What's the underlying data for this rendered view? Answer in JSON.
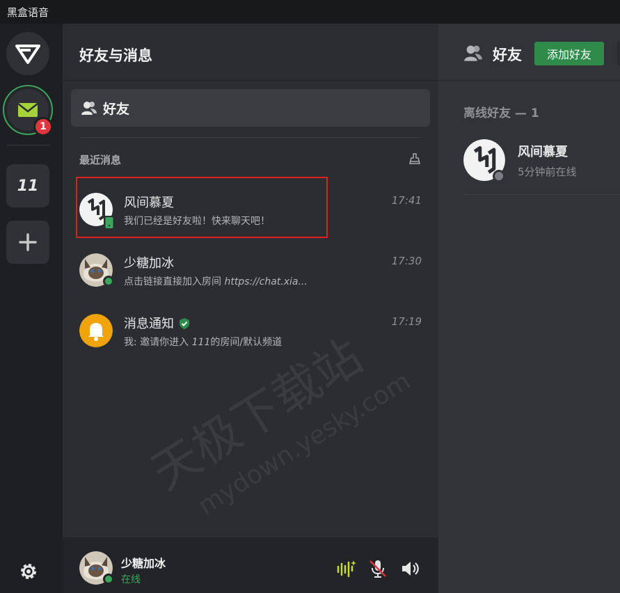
{
  "app": {
    "title": "黑盒语音"
  },
  "rail": {
    "mail_badge": "1",
    "server_label": "11"
  },
  "mid": {
    "header": "好友与消息",
    "friends_button": "好友",
    "recent_label": "最近消息",
    "messages": [
      {
        "name": "风间慕夏",
        "time": "17:41",
        "preview": "我们已经是好友啦！快来聊天吧！"
      },
      {
        "name": "少糖加冰",
        "time": "17:30",
        "preview_prefix": "点击链接直接加入房间 ",
        "preview_link": "https://chat.xia..."
      },
      {
        "name": "消息通知",
        "time": "17:19",
        "preview_prefix": "我: 邀请你进入 ",
        "preview_num": "111",
        "preview_suffix": "的房间/默认频道"
      }
    ]
  },
  "user": {
    "name": "少糖加冰",
    "status": "在线"
  },
  "right": {
    "title": "好友",
    "add_friend": "添加好友",
    "offline_label": "离线好友 — 1",
    "friends": [
      {
        "name": "风间慕夏",
        "status": "5分钟前在线"
      }
    ]
  },
  "watermark": {
    "line1": "天极下载站",
    "line2": "mydown.yesky.com"
  },
  "colors": {
    "accent_green": "#3ba55c",
    "badge_red": "#e0373f",
    "highlight_red": "#e02020",
    "add_button": "#2e8b4a"
  }
}
